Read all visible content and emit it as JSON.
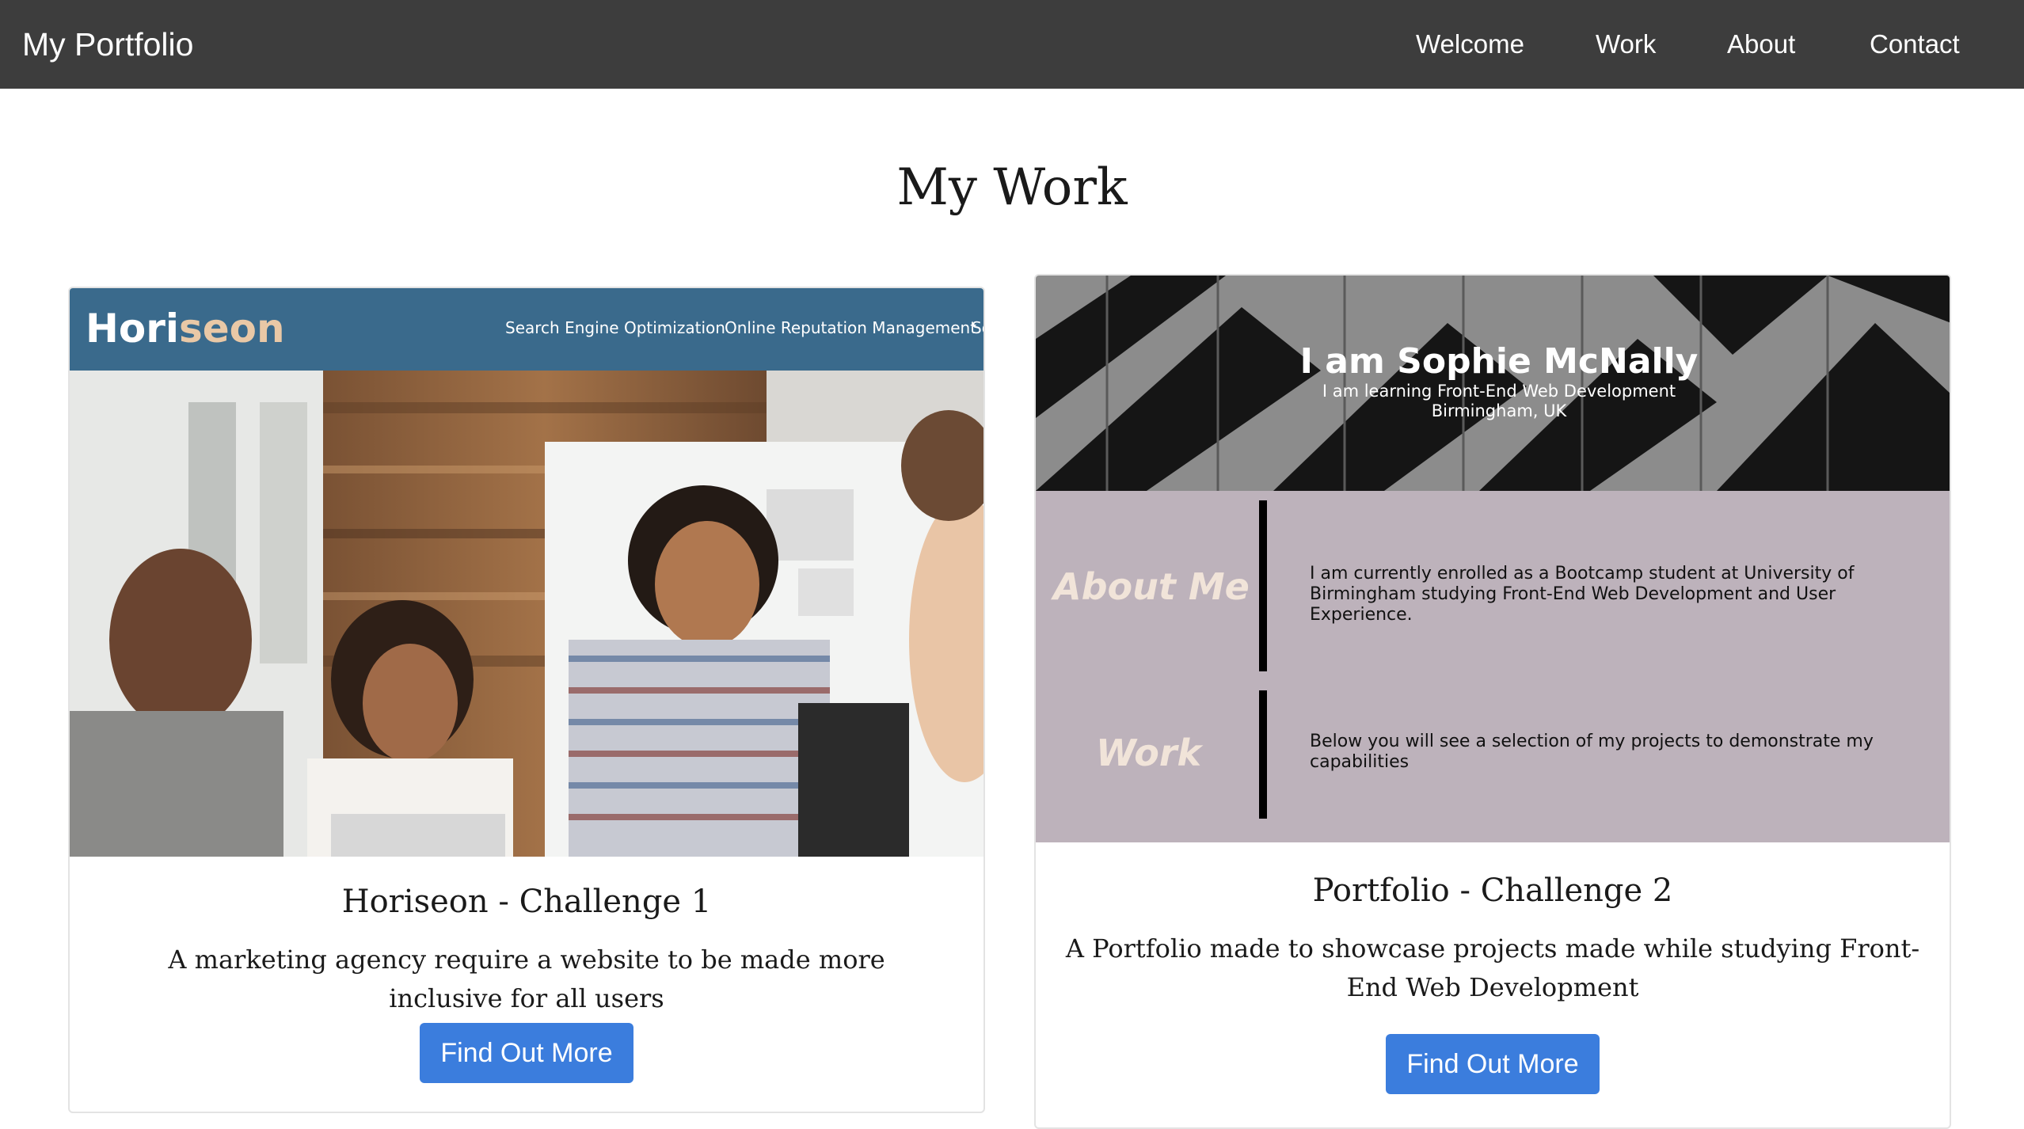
{
  "navbar": {
    "brand": "My Portfolio",
    "links": [
      "Welcome",
      "Work",
      "About",
      "Contact"
    ]
  },
  "page": {
    "title": "My Work"
  },
  "cards": [
    {
      "title": "Horiseon - Challenge 1",
      "text": "A marketing agency require a website to be made more inclusive for all users",
      "button": "Find Out More",
      "screenshot": {
        "logo_dark": "Hori",
        "logo_light": "seon",
        "menu": [
          "Search Engine Optimization",
          "Online Reputation Management",
          "So"
        ]
      }
    },
    {
      "title": "Portfolio - Challenge 2",
      "text": "A Portfolio made to showcase projects made while studying Front-End Web Development",
      "button": "Find Out More",
      "screenshot": {
        "hero_title": "I am Sophie McNally",
        "hero_sub1": "I am learning Front-End Web Development",
        "hero_sub2": "Birmingham, UK",
        "about_label": "About Me",
        "about_text": "I am currently enrolled as a Bootcamp student at University of Birmingham studying Front-End Web Development and User Experience.",
        "work_label": "Work",
        "work_text": "Below you will see a selection of my projects to demonstrate my capabilities"
      }
    }
  ],
  "colors": {
    "navbar": "#3d3d3d",
    "button": "#3b7ddd",
    "horiseon_header": "#3a6a8c",
    "portfolio_section": "#bdb2bb"
  }
}
